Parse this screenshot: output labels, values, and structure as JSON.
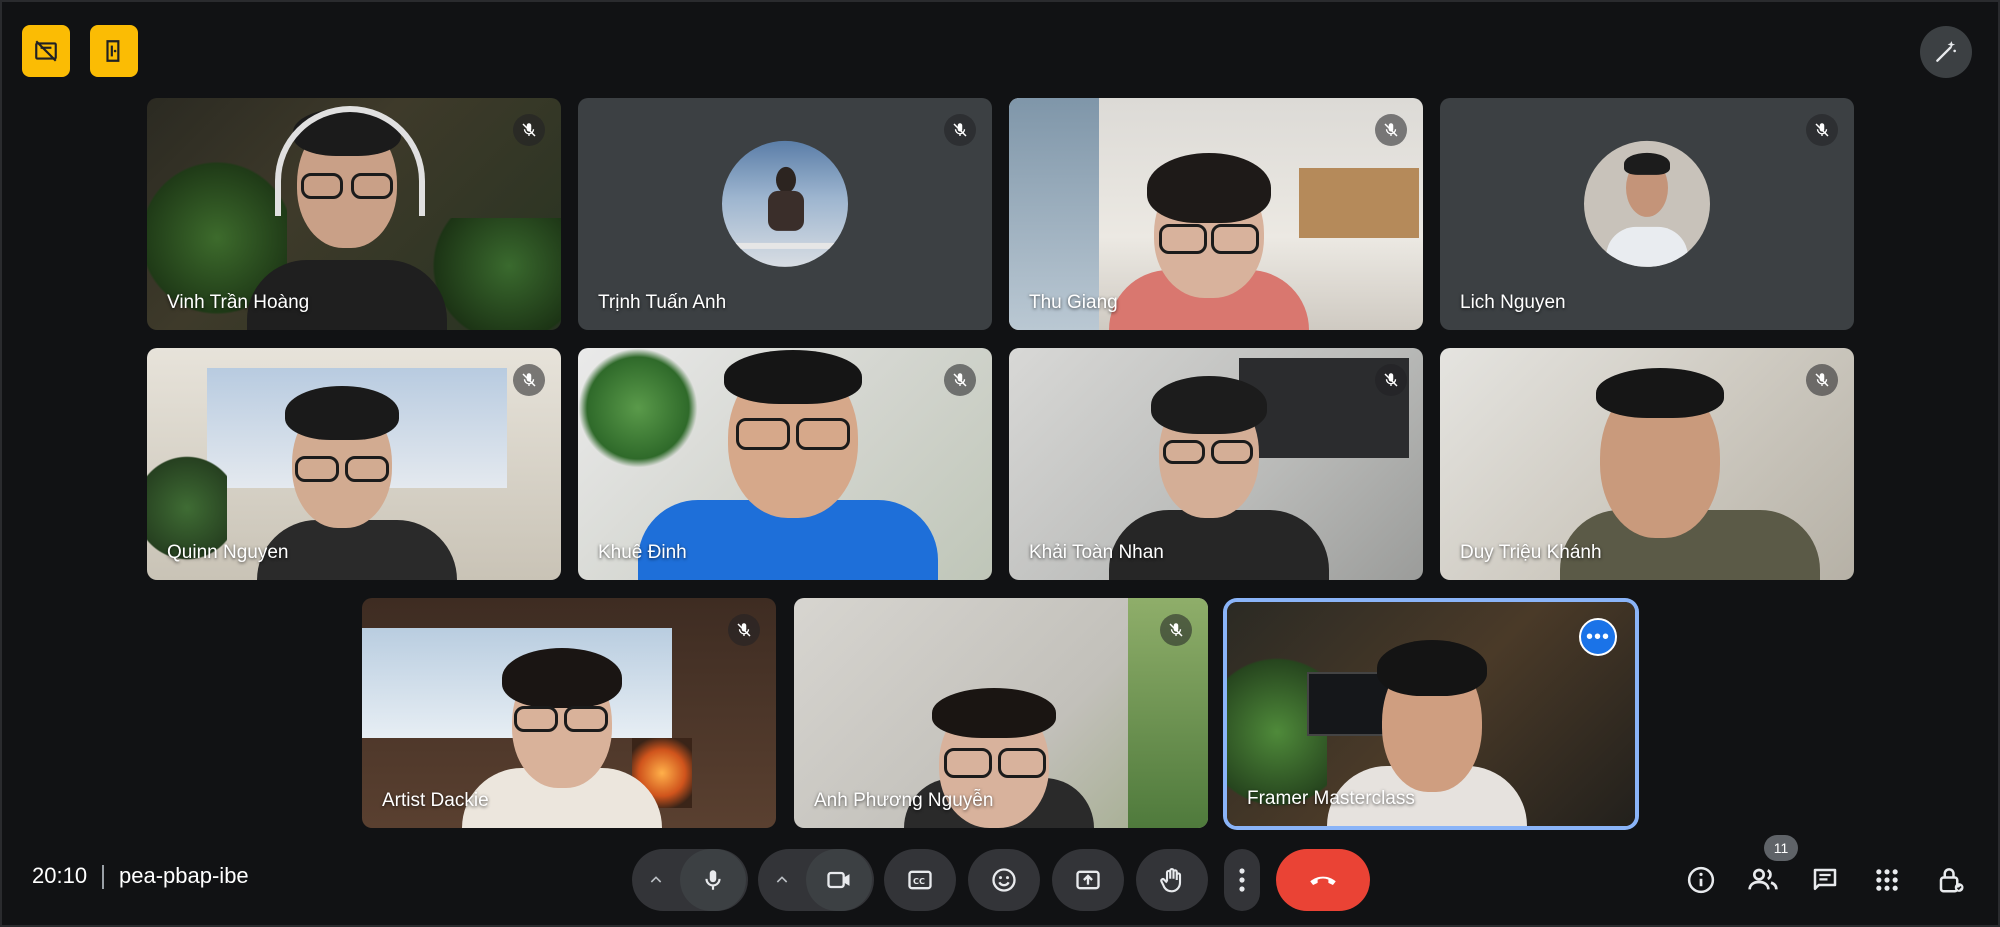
{
  "meeting": {
    "time": "20:10",
    "code": "pea-pbap-ibe"
  },
  "participants": [
    {
      "name": "Vinh Trần Hoàng"
    },
    {
      "name": "Trịnh Tuấn Anh"
    },
    {
      "name": "Thu Giang"
    },
    {
      "name": "Lich Nguyen"
    },
    {
      "name": "Quinn Nguyen"
    },
    {
      "name": "Khuê Đinh"
    },
    {
      "name": "Khải Toàn Nhan"
    },
    {
      "name": "Duy Triệu Khánh"
    },
    {
      "name": "Artist Dackie"
    },
    {
      "name": "Anh Phương Nguyễn"
    },
    {
      "name": "Framer Masterclass"
    }
  ],
  "people_count": "11",
  "colors": {
    "accent": "#8ab4f8",
    "end_call": "#ea4335",
    "host_tools": "#fbbc04",
    "background": "#111214"
  },
  "icons": [
    "host-controls-icon",
    "exit-door-icon",
    "visual-effects-icon",
    "mic-off-icon",
    "more-options-icon",
    "chevron-up-icon",
    "microphone-icon",
    "camera-icon",
    "captions-icon",
    "emoji-icon",
    "present-screen-icon",
    "raise-hand-icon",
    "more-vert-icon",
    "end-call-icon",
    "info-icon",
    "people-icon",
    "chat-icon",
    "apps-icon",
    "host-lock-icon"
  ]
}
